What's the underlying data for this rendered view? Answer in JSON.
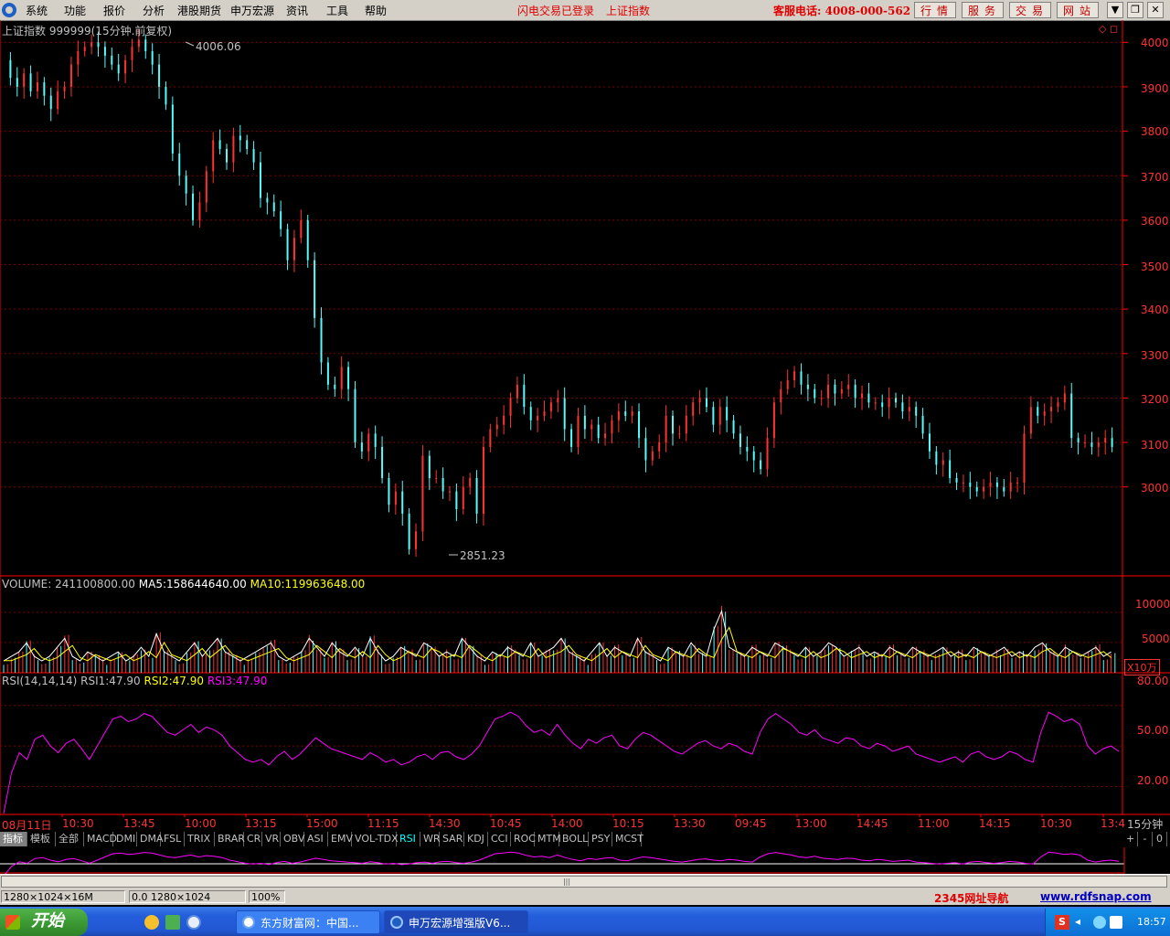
{
  "menu": [
    "系统",
    "功能",
    "报价",
    "分析",
    "港股期货",
    "申万宏源",
    "资讯",
    "工具",
    "帮助"
  ],
  "login_status": "闪电交易已登录",
  "current_index": "上证指数",
  "hotline": "客服电话: 4008-000-562",
  "service_buttons": [
    "行情",
    "服务",
    "交易",
    "网站"
  ],
  "window_buttons": [
    "▼",
    "❐",
    "✕"
  ],
  "chart_title": "上证指数 999999(15分钟.前复权)",
  "high_label": "4006.06",
  "low_label": "2851.23",
  "price_axis": [
    "4000",
    "3900",
    "3800",
    "3700",
    "3600",
    "3500",
    "3400",
    "3300",
    "3200",
    "3100",
    "3000"
  ],
  "volume_header": {
    "name": "VOLUME:",
    "value": "241100800.00",
    "ma5_label": "MA5:",
    "ma5": "158644640.00",
    "ma10_label": "MA10:",
    "ma10": "119963648.00"
  },
  "volume_axis": [
    "10000",
    "5000"
  ],
  "volume_unit": "X10万",
  "rsi_header": {
    "name": "RSI(14,14,14)",
    "rsi1_label": "RSI1:",
    "rsi1": "47.90",
    "rsi2_label": "RSI2:",
    "rsi2": "47.90",
    "rsi3_label": "RSI3:",
    "rsi3": "47.90"
  },
  "rsi_axis": [
    "80.00",
    "50.00",
    "20.00"
  ],
  "time_axis": [
    "08月11日",
    "10:30",
    "13:45",
    "10:00",
    "13:15",
    "15:00",
    "11:15",
    "14:30",
    "10:45",
    "14:00",
    "10:15",
    "13:30",
    "09:45",
    "13:00",
    "14:45",
    "11:00",
    "14:15",
    "10:30",
    "13:4"
  ],
  "period": "15分钟",
  "indicator_tabs": [
    "指标",
    "模板",
    "全部",
    "MACD",
    "DMI",
    "DMA",
    "FSL",
    "TRIX",
    "BRAR",
    "CR",
    "VR",
    "OBV",
    "ASI",
    "EMV",
    "VOL-TDX",
    "RSI",
    "WR",
    "SAR",
    "KDJ",
    "CCI",
    "ROC",
    "MTM",
    "BOLL",
    "PSY",
    "MCST"
  ],
  "active_tab": "RSI",
  "tab_controls": [
    "+",
    "-",
    "0"
  ],
  "status_cells": [
    "1280×1024×16M",
    "0.0 1280×1024",
    "100%"
  ],
  "status_links": {
    "nav": "2345网址导航",
    "site": "www.rdfsnap.com"
  },
  "taskbar": {
    "start": "开始",
    "tasks": [
      "东方财富网：中国...",
      "申万宏源增强版V6..."
    ],
    "clock": "18:57"
  },
  "colors": {
    "up": "#ff3232",
    "down": "#54fcfc",
    "ma5": "#ffffff",
    "ma10": "#ffff00",
    "rsi": "#ff00ff",
    "grid": "#800000",
    "axis": "#ff0000",
    "label": "#ff3232"
  },
  "chart_data": {
    "type": "candlestick",
    "interval": "15分钟",
    "ylim": [
      2800,
      4050
    ],
    "high": 4006.06,
    "low": 2851.23,
    "close_path": [
      3960,
      3920,
      3900,
      3930,
      3890,
      3910,
      3880,
      3850,
      3890,
      3900,
      3950,
      3980,
      3990,
      4000,
      3990,
      3970,
      3950,
      3930,
      3960,
      3990,
      4006,
      3980,
      3950,
      3900,
      3860,
      3750,
      3700,
      3660,
      3600,
      3640,
      3710,
      3780,
      3760,
      3730,
      3790,
      3780,
      3760,
      3730,
      3650,
      3640,
      3620,
      3580,
      3510,
      3560,
      3600,
      3510,
      3380,
      3280,
      3230,
      3220,
      3270,
      3220,
      3100,
      3080,
      3120,
      3090,
      3020,
      2960,
      2990,
      2940,
      2860,
      2900,
      3070,
      3020,
      3020,
      2990,
      2990,
      2950,
      3000,
      3020,
      2940,
      3090,
      3130,
      3140,
      3160,
      3200,
      3230,
      3180,
      3150,
      3160,
      3170,
      3190,
      3200,
      3130,
      3090,
      3160,
      3130,
      3140,
      3110,
      3120,
      3150,
      3170,
      3160,
      3170,
      3110,
      3060,
      3080,
      3100,
      3160,
      3120,
      3120,
      3160,
      3190,
      3200,
      3180,
      3140,
      3180,
      3150,
      3120,
      3090,
      3080,
      3060,
      3040,
      3110,
      3190,
      3220,
      3240,
      3260,
      3230,
      3220,
      3200,
      3200,
      3230,
      3210,
      3220,
      3230,
      3200,
      3210,
      3190,
      3190,
      3180,
      3200,
      3190,
      3170,
      3180,
      3160,
      3120,
      3080,
      3050,
      3060,
      3020,
      3010,
      3010,
      3000,
      2990,
      3000,
      3010,
      3000,
      2990,
      3010,
      3010,
      3120,
      3180,
      3160,
      3170,
      3180,
      3190,
      3210,
      3110,
      3100,
      3100,
      3090,
      3100,
      3110,
      3090
    ],
    "volume_ylim": [
      0,
      13000
    ],
    "rsi_ylim": [
      0,
      90
    ],
    "rsi_path": [
      0,
      30,
      45,
      40,
      55,
      58,
      50,
      45,
      52,
      55,
      48,
      40,
      50,
      60,
      70,
      72,
      68,
      70,
      74,
      72,
      66,
      60,
      58,
      62,
      66,
      60,
      64,
      62,
      58,
      50,
      45,
      40,
      38,
      40,
      36,
      42,
      46,
      40,
      44,
      50,
      56,
      52,
      48,
      46,
      44,
      42,
      40,
      45,
      42,
      38,
      40,
      36,
      38,
      42,
      44,
      40,
      45,
      46,
      42,
      40,
      44,
      50,
      60,
      70,
      72,
      75,
      72,
      65,
      60,
      62,
      58,
      66,
      58,
      52,
      48,
      55,
      52,
      56,
      58,
      50,
      48,
      55,
      60,
      58,
      54,
      50,
      46,
      44,
      48,
      52,
      54,
      50,
      48,
      52,
      50,
      46,
      44,
      60,
      70,
      74,
      70,
      66,
      60,
      58,
      62,
      56,
      54,
      52,
      56,
      55,
      50,
      48,
      52,
      50,
      46,
      48,
      50,
      44,
      42,
      40,
      38,
      40,
      42,
      38,
      44,
      46,
      42,
      40,
      42,
      46,
      44,
      40,
      38,
      60,
      75,
      72,
      68,
      70,
      66,
      50,
      44,
      48,
      50,
      46
    ],
    "vol_path": [
      1,
      2,
      3,
      5,
      2,
      1,
      2,
      4,
      6,
      2,
      1,
      3,
      2,
      1,
      2,
      3,
      1,
      2,
      4,
      2,
      7,
      3,
      2,
      1,
      3,
      5,
      2,
      4,
      6,
      3,
      2,
      1,
      2,
      3,
      4,
      5,
      2,
      1,
      2,
      3,
      6,
      4,
      2,
      5,
      3,
      2,
      4,
      2,
      6,
      3,
      1,
      2,
      4,
      3,
      2,
      5,
      4,
      2,
      3,
      2,
      6,
      4,
      2,
      1,
      3,
      2,
      4,
      3,
      2,
      5,
      2,
      3,
      4,
      6,
      3,
      2,
      1,
      3,
      5,
      2,
      4,
      3,
      2,
      6,
      3,
      2,
      1,
      4,
      3,
      2,
      5,
      3,
      2,
      8,
      12,
      4,
      3,
      2,
      4,
      3,
      2,
      5,
      4,
      3,
      2,
      4,
      2,
      3,
      5,
      4,
      2,
      3,
      4,
      2,
      3,
      2,
      4,
      3,
      2,
      4,
      3,
      2,
      3,
      4,
      2,
      3,
      2,
      4,
      3,
      2,
      3,
      4,
      2,
      3,
      2,
      4,
      5,
      3,
      2,
      4,
      3,
      2,
      3,
      4,
      2,
      3
    ]
  }
}
